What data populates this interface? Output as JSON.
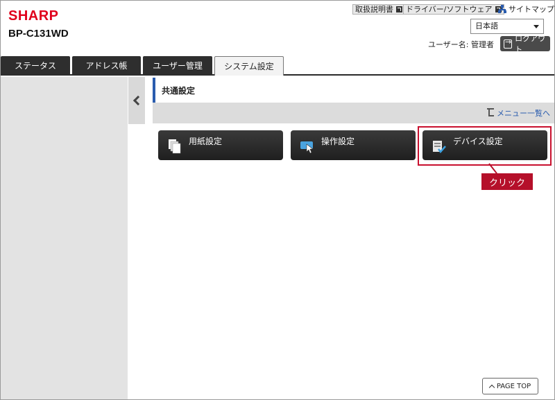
{
  "header": {
    "brand": "SHARP",
    "model": "BP-C131WD",
    "links": [
      {
        "label": "取扱説明書"
      },
      {
        "label": "ドライバー/ソフトウェア"
      }
    ],
    "sitemap_label": "サイトマップ",
    "language": "日本語",
    "username_label": "ユーザー名: 管理者",
    "logout_label": "ログアウト"
  },
  "tabs": [
    {
      "label": "ステータス"
    },
    {
      "label": "アドレス帳"
    },
    {
      "label": "ユーザー管理"
    },
    {
      "label": "システム設定",
      "active": true
    }
  ],
  "main": {
    "section_title": "共通設定",
    "menu_link": "メニュー一覧へ",
    "buttons": [
      {
        "label": "用紙設定"
      },
      {
        "label": "操作設定"
      },
      {
        "label": "デバイス設定"
      }
    ],
    "callout": "クリック",
    "page_top": "PAGE TOP"
  },
  "colors": {
    "brand": "#e0001b",
    "accent": "#2a5cae",
    "highlight": "#c8102e",
    "button_bg": "#2b2b2b"
  }
}
